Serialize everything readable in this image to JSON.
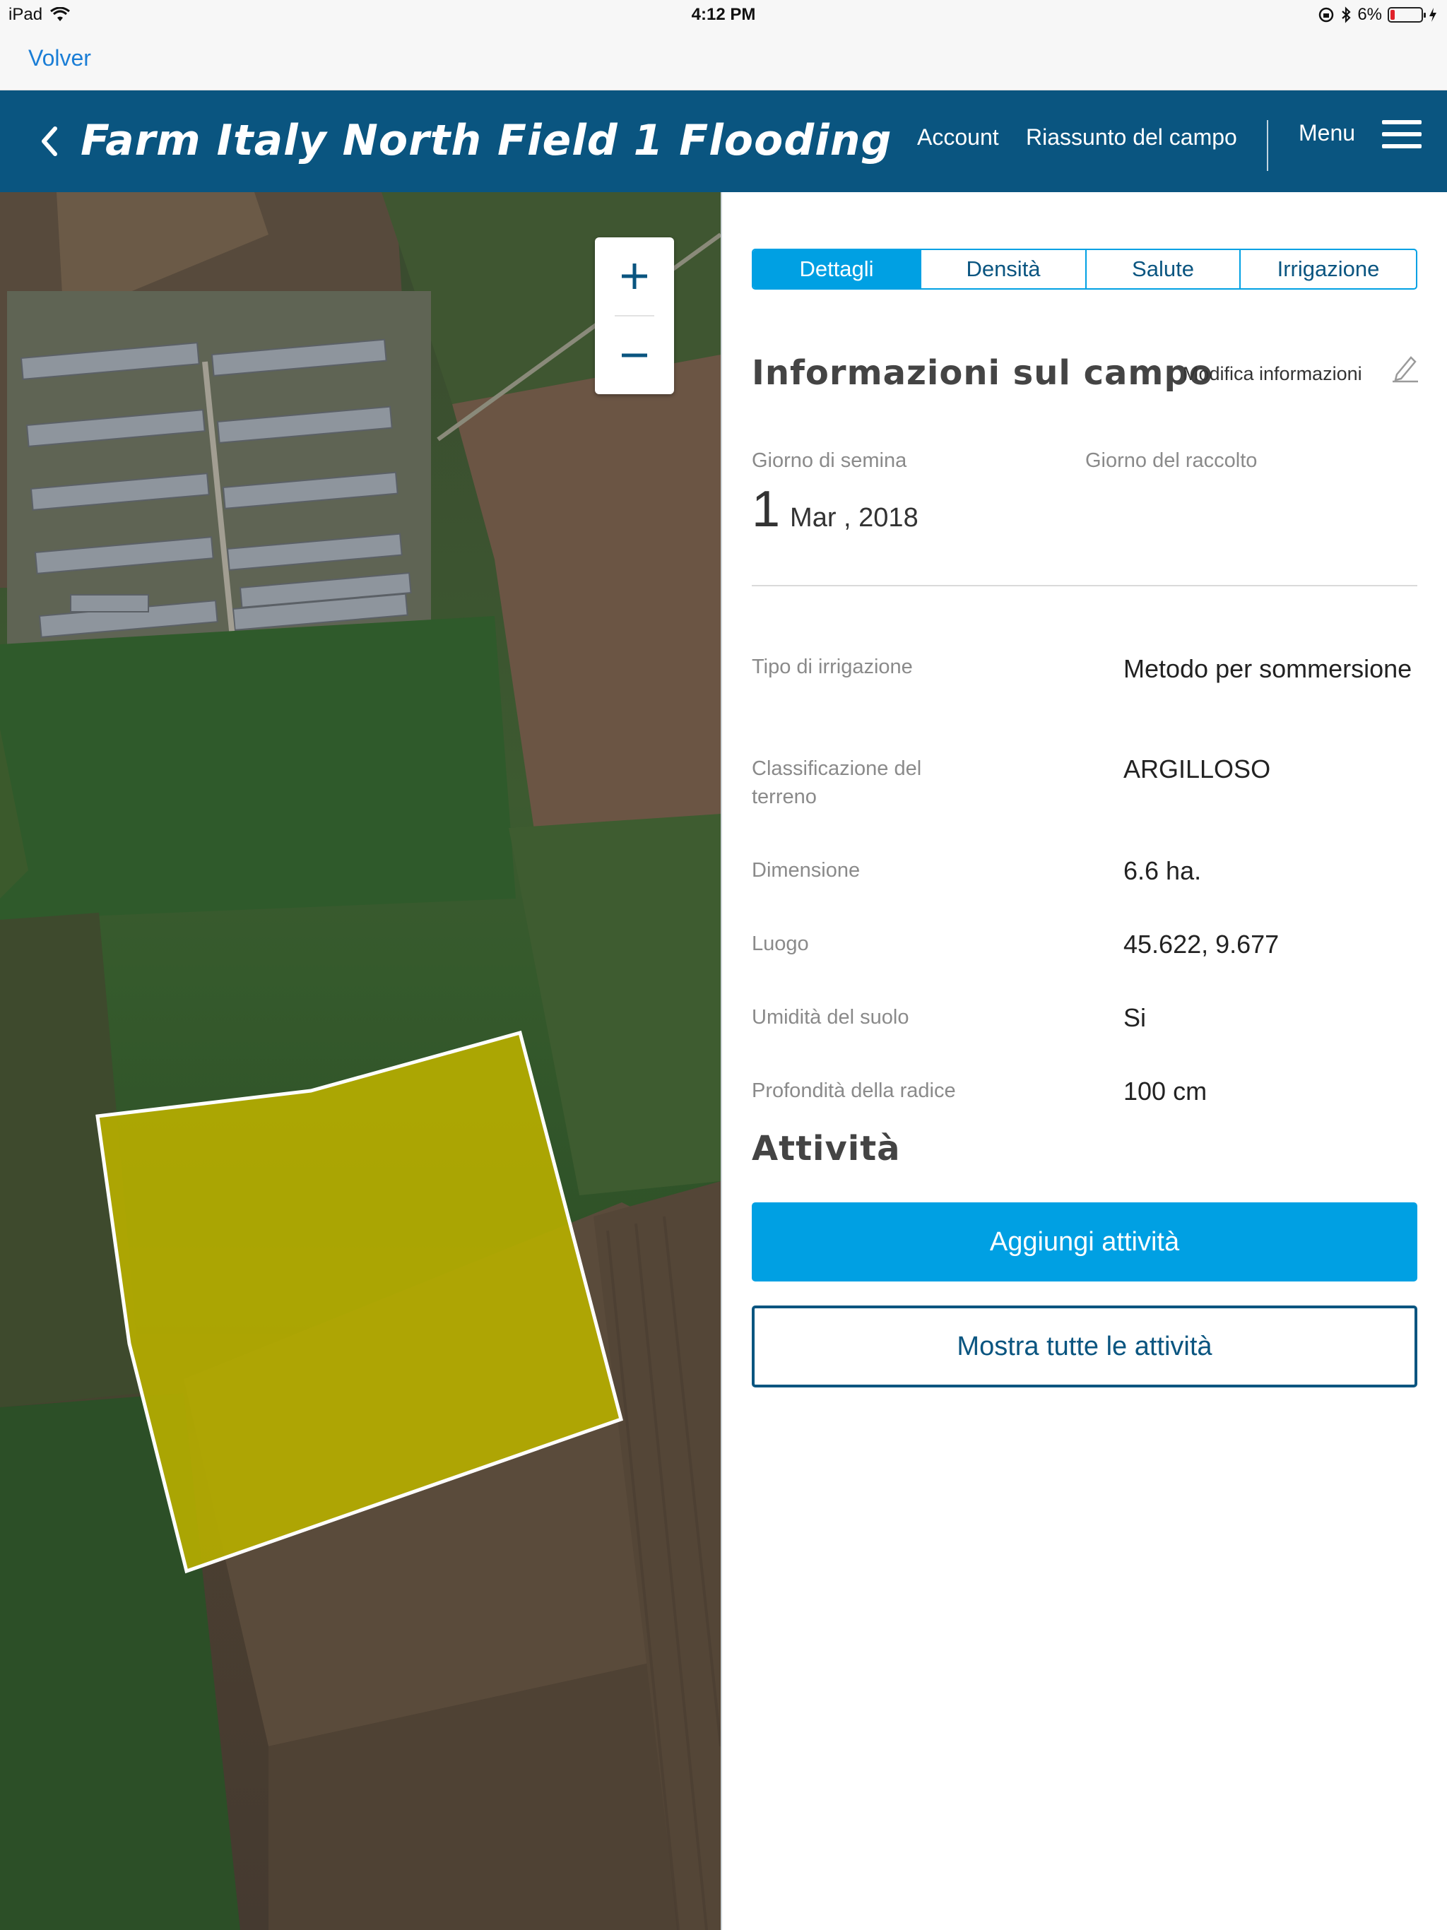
{
  "status_bar": {
    "device": "iPad",
    "time": "4:12 PM",
    "battery": "6%"
  },
  "back_bar": {
    "label": "Volver"
  },
  "header": {
    "title": "Farm Italy North Field 1 Flooding",
    "nav": {
      "account": "Account",
      "summary": "Riassunto del campo",
      "menu": "Menu"
    }
  },
  "map": {
    "field_color": "#b5ad00",
    "zoom_in": "+",
    "zoom_out": "−"
  },
  "tabs": [
    {
      "label": "Dettagli",
      "active": true
    },
    {
      "label": "Densità",
      "active": false
    },
    {
      "label": "Salute",
      "active": false
    },
    {
      "label": "Irrigazione",
      "active": false
    }
  ],
  "info": {
    "title": "Informazioni sul campo",
    "edit_label": "Modifica informazioni",
    "sowing_label": "Giorno di semina",
    "harvest_label": "Giorno del raccolto",
    "sowing_day": "1",
    "sowing_rest": "Mar , 2018",
    "rows": [
      {
        "label": "Tipo di irrigazione",
        "value": "Metodo per sommersione"
      },
      {
        "label": "Classificazione del terreno",
        "value": "ARGILLOSO"
      },
      {
        "label": "Dimensione",
        "value": "6.6 ha."
      },
      {
        "label": "Luogo",
        "value": "45.622, 9.677"
      },
      {
        "label": "Umidità del suolo",
        "value": "Si"
      },
      {
        "label": "Profondità della radice",
        "value": "100 cm"
      }
    ]
  },
  "activities": {
    "title": "Attività",
    "add_label": "Aggiungi attività",
    "show_all_label": "Mostra tutte le attività"
  },
  "colors": {
    "header": "#0a5580",
    "accent": "#00a0e3",
    "link": "#1b7ed6"
  }
}
